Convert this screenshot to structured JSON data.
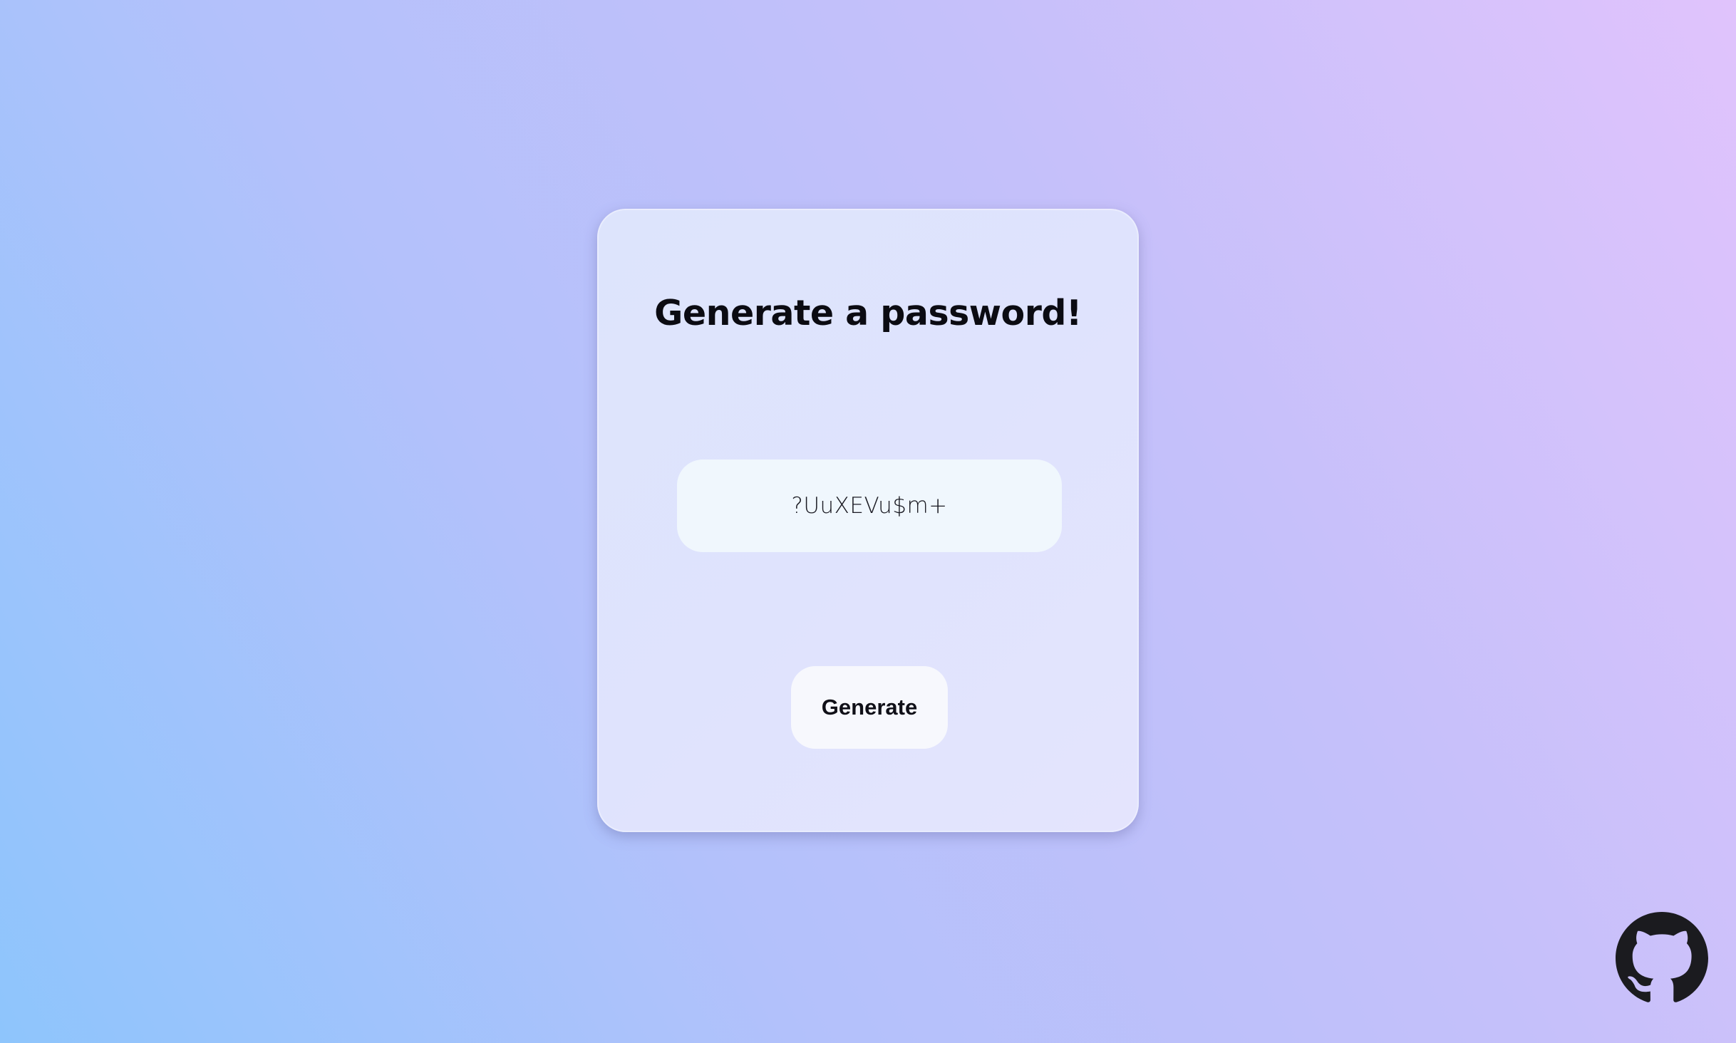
{
  "card": {
    "title": "Generate a password!",
    "password_value": "?UuXEVu$m+",
    "generate_label": "Generate"
  },
  "footer": {
    "github_icon": "github-icon"
  },
  "colors": {
    "background_start": "#8ec5fc",
    "background_end": "#e0c3fc",
    "card_background": "#dfe3fd",
    "password_box_background": "#f0f7fd",
    "button_background": "#f7f8fd",
    "text": "#0b0b12"
  }
}
